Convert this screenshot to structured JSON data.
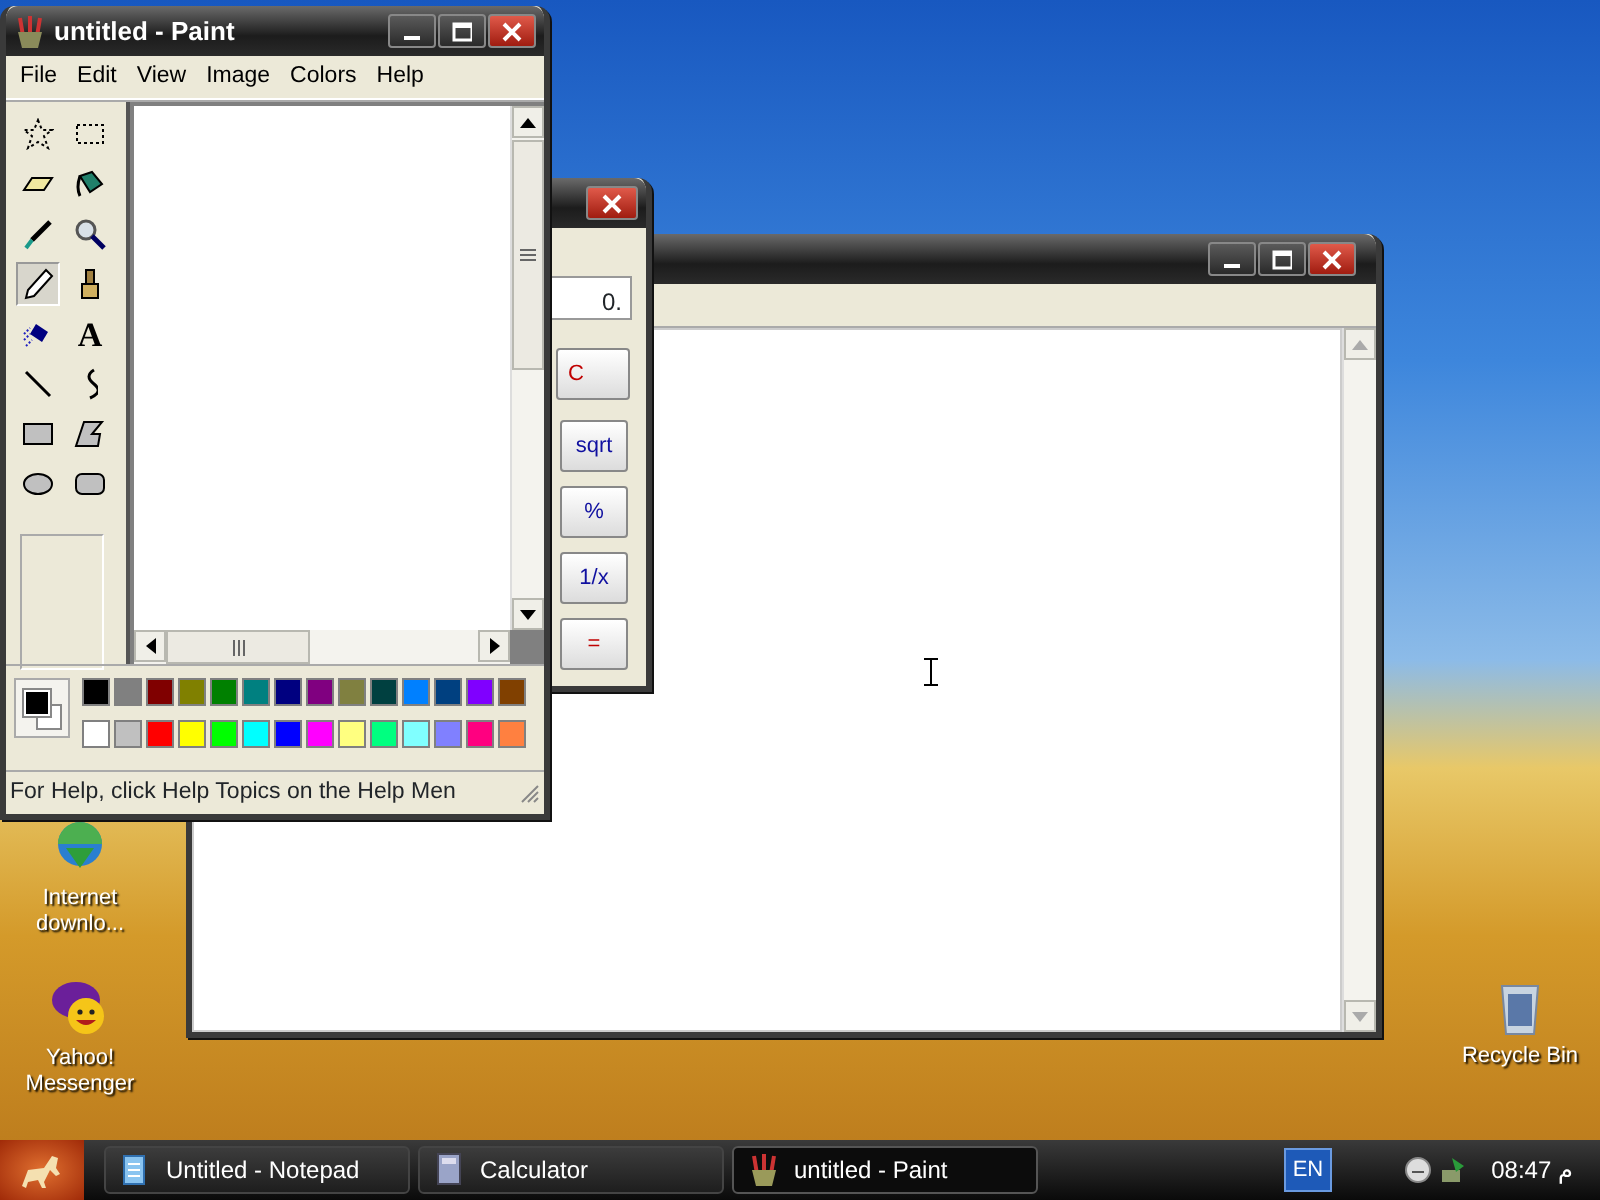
{
  "desktop": {
    "icons": [
      {
        "kind": "download",
        "label": "Internet downlo..."
      },
      {
        "kind": "messenger",
        "label": "Yahoo! Messenger"
      },
      {
        "kind": "recycle-bin",
        "label": "Recycle Bin"
      }
    ]
  },
  "calculator_window": {
    "display": "0.",
    "buttons": [
      {
        "label": "C",
        "color": "#c00000"
      },
      {
        "label": "sqrt",
        "color": "#1010a0"
      },
      {
        "label": "%",
        "color": "#1010a0"
      },
      {
        "label": "1/x",
        "color": "#1010a0"
      },
      {
        "label": "=",
        "color": "#c00000"
      }
    ]
  },
  "paint_window": {
    "title": "untitled - Paint",
    "menu": [
      "File",
      "Edit",
      "View",
      "Image",
      "Colors",
      "Help"
    ],
    "tools": [
      {
        "kind": "free-select",
        "selected": false
      },
      {
        "kind": "select",
        "selected": false
      },
      {
        "kind": "eraser",
        "selected": false
      },
      {
        "kind": "fill",
        "selected": false
      },
      {
        "kind": "picker",
        "selected": false
      },
      {
        "kind": "magnifier",
        "selected": false
      },
      {
        "kind": "pencil",
        "selected": true
      },
      {
        "kind": "brush",
        "selected": false
      },
      {
        "kind": "airbrush",
        "selected": false
      },
      {
        "kind": "text",
        "glyph": "A",
        "selected": false
      },
      {
        "kind": "line",
        "selected": false
      },
      {
        "kind": "curve",
        "selected": false
      },
      {
        "kind": "rectangle",
        "selected": false
      },
      {
        "kind": "polygon",
        "selected": false
      },
      {
        "kind": "ellipse",
        "selected": false
      },
      {
        "kind": "rounded-rectangle",
        "selected": false
      }
    ],
    "current_colors": [
      {
        "kind": "foreground",
        "color": "#000000"
      },
      {
        "kind": "background",
        "color": "#ffffff"
      }
    ],
    "palette": [
      {
        "color": "#000000"
      },
      {
        "color": "#808080"
      },
      {
        "color": "#800000"
      },
      {
        "color": "#808000"
      },
      {
        "color": "#008000"
      },
      {
        "color": "#008080"
      },
      {
        "color": "#000080"
      },
      {
        "color": "#800080"
      },
      {
        "color": "#808040"
      },
      {
        "color": "#004040"
      },
      {
        "color": "#0080ff"
      },
      {
        "color": "#004080"
      },
      {
        "color": "#8000ff"
      },
      {
        "color": "#804000"
      },
      {
        "color": "#ffffff"
      },
      {
        "color": "#c0c0c0"
      },
      {
        "color": "#ff0000"
      },
      {
        "color": "#ffff00"
      },
      {
        "color": "#00ff00"
      },
      {
        "color": "#00ffff"
      },
      {
        "color": "#0000ff"
      },
      {
        "color": "#ff00ff"
      },
      {
        "color": "#ffff80"
      },
      {
        "color": "#00ff80"
      },
      {
        "color": "#80ffff"
      },
      {
        "color": "#8080ff"
      },
      {
        "color": "#ff0080"
      },
      {
        "color": "#ff8040"
      }
    ],
    "status_bar": "For Help, click Help Topics on the Help Men"
  },
  "taskbar": {
    "tasks": [
      {
        "kind": "notepad",
        "label": "Untitled - Notepad",
        "selected": false
      },
      {
        "kind": "calculator",
        "label": "Calculator",
        "selected": false
      },
      {
        "kind": "paint",
        "label": "untitled - Paint",
        "selected": true
      }
    ],
    "language": "EN",
    "clock": "08:47 م"
  }
}
